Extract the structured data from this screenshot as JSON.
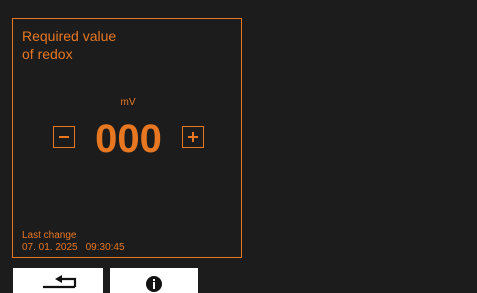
{
  "colors": {
    "background": "#1c1c1c",
    "accent": "#e87722",
    "softkey_background": "#ffffff",
    "icon": "#111111"
  },
  "panel": {
    "title": "Required value\nof redox",
    "unit": "mV",
    "value": "000",
    "decrement_icon": "minus-icon",
    "increment_icon": "plus-icon",
    "last_change": {
      "label": "Last change",
      "date": "07. 01. 2025",
      "time": "09:30:45"
    }
  },
  "softkeys": [
    {
      "icon": "return-arrow-icon"
    },
    {
      "icon": "info-icon"
    }
  ]
}
